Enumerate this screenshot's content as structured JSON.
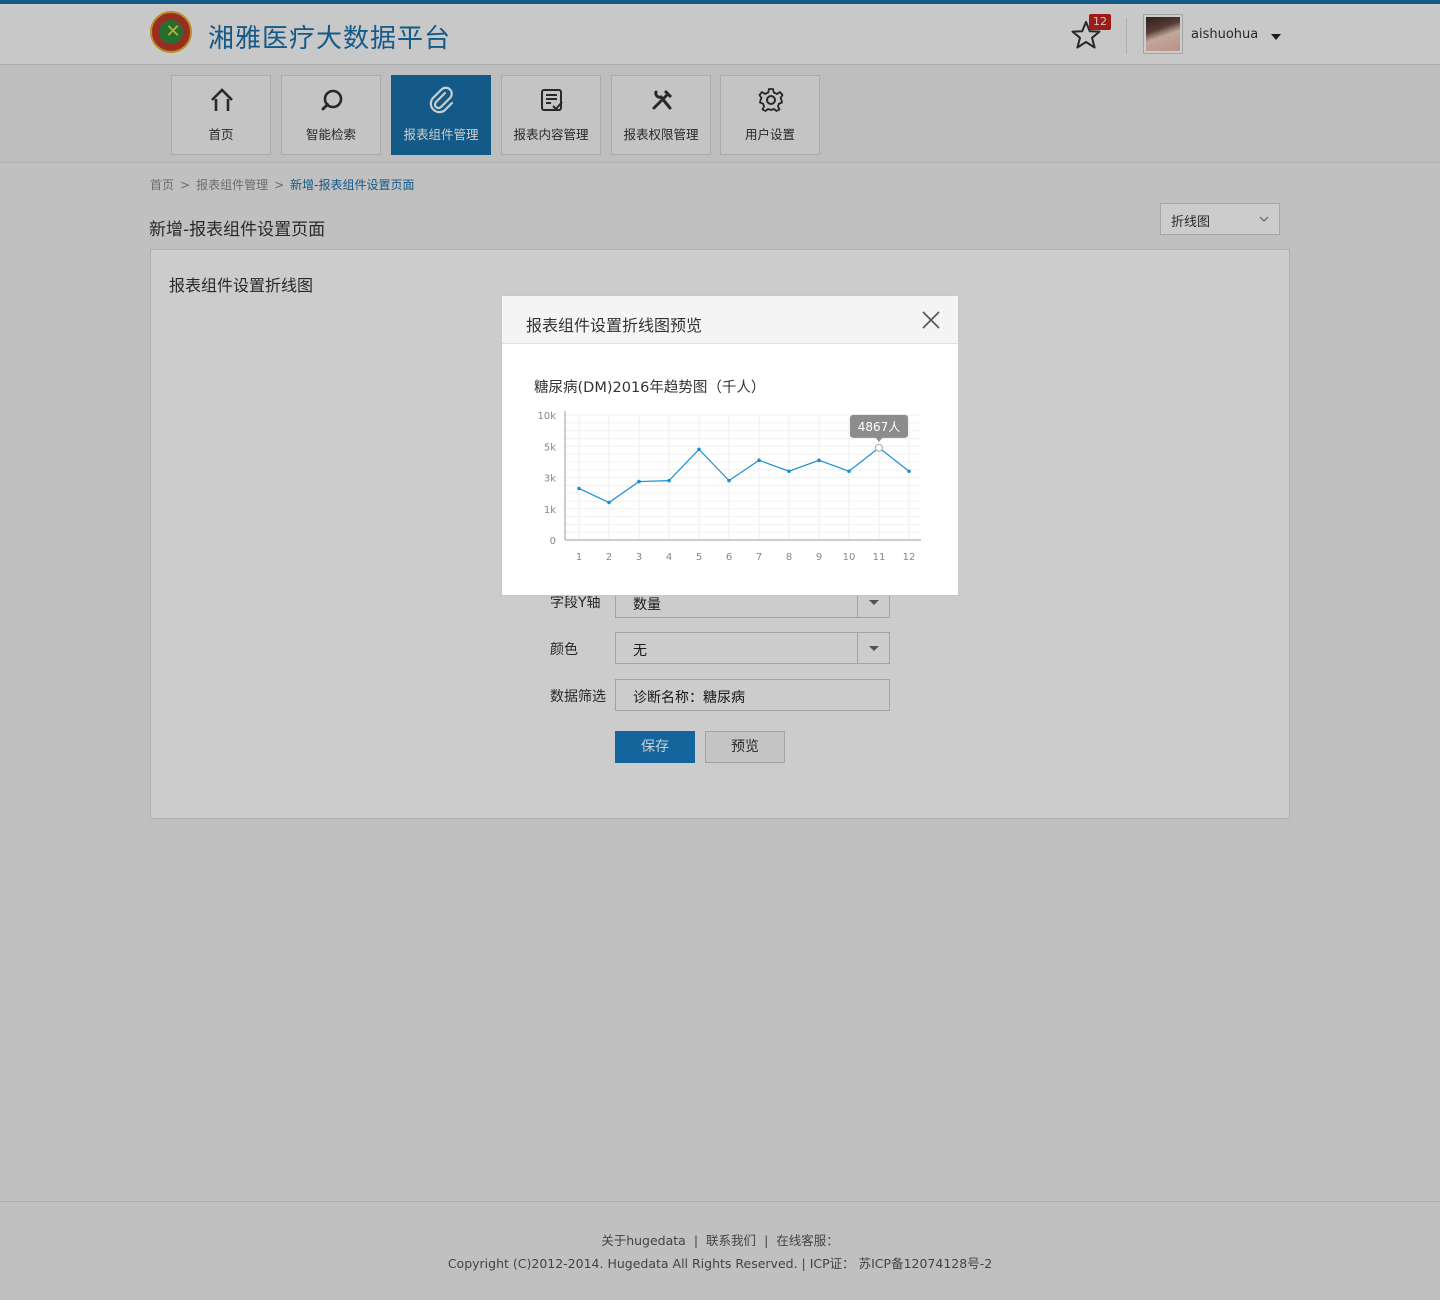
{
  "app": {
    "title": "湘雅医疗大数据平台"
  },
  "header": {
    "favorites_count": "12",
    "username": "aishuohua"
  },
  "nav": {
    "items": [
      {
        "label": "首页",
        "icon": "home-icon"
      },
      {
        "label": "智能检索",
        "icon": "search-icon"
      },
      {
        "label": "报表组件管理",
        "icon": "paperclip-icon",
        "active": true
      },
      {
        "label": "报表内容管理",
        "icon": "report-check-icon"
      },
      {
        "label": "报表权限管理",
        "icon": "tools-icon"
      },
      {
        "label": "用户设置",
        "icon": "gear-icon"
      }
    ]
  },
  "breadcrumb": {
    "items": [
      "首页",
      "报表组件管理",
      "新增-报表组件设置页面"
    ],
    "separator": ">"
  },
  "page": {
    "title": "新增-报表组件设置页面",
    "chart_type_select": "折线图",
    "panel_title": "报表组件设置折线图"
  },
  "form": {
    "y_axis_label": "字段Y轴",
    "y_axis_value": "数量",
    "color_label": "颜色",
    "color_value": "无",
    "filter_label": "数据筛选",
    "filter_value": "诊断名称：糖尿病",
    "save_label": "保存",
    "preview_label": "预览"
  },
  "modal": {
    "title": "报表组件设置折线图预览",
    "chart_title": "糖尿病(DM)2016年趋势图（千人）"
  },
  "chart_data": {
    "type": "line",
    "title": "糖尿病(DM)2016年趋势图（千人）",
    "x": [
      1,
      2,
      3,
      4,
      5,
      6,
      7,
      8,
      9,
      10,
      11,
      12
    ],
    "ytick_labels": [
      "0",
      "1k",
      "3k",
      "5k",
      "10k"
    ],
    "y_tick_positions": [
      0,
      1,
      2,
      3,
      4
    ],
    "series": [
      {
        "values": [
          1.65,
          1.2,
          1.87,
          1.9,
          2.9,
          1.9,
          2.55,
          2.2,
          2.55,
          2.2,
          2.95,
          2.2
        ]
      }
    ],
    "tooltip": {
      "x": 11,
      "text": "4867人"
    },
    "grid": true,
    "line_color": "#1a8fd0"
  },
  "footer": {
    "links": [
      "关于hugedata",
      "联系我们",
      "在线客服："
    ],
    "copyright": "Copyright (C)2012-2014. Hugedata All Rights Reserved. | ICP证： 苏ICP备12074128号-2"
  }
}
